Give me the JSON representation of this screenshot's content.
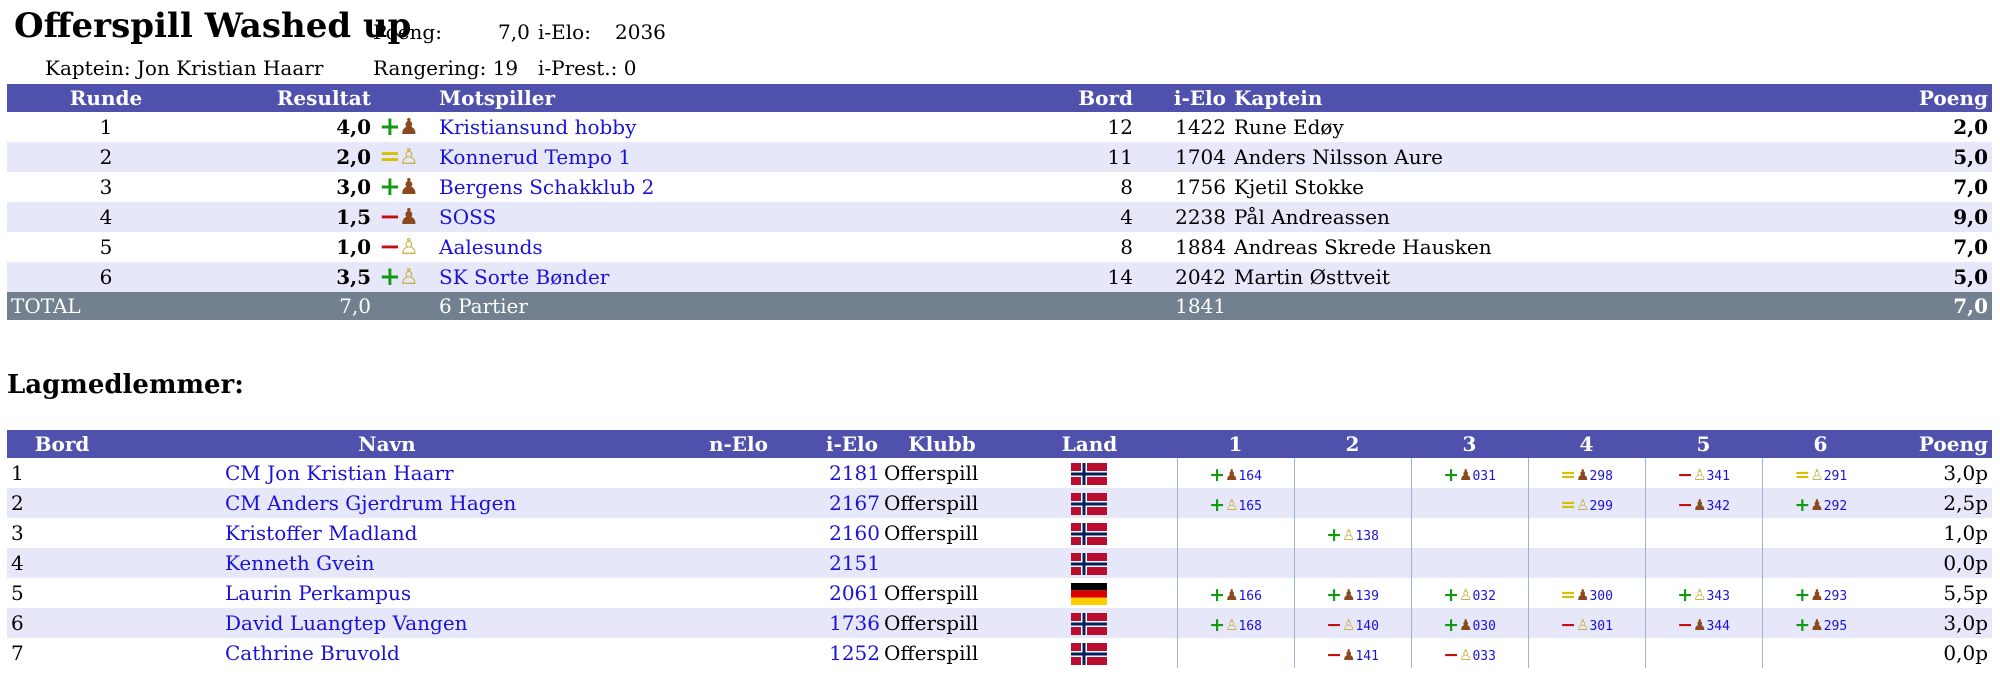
{
  "team": {
    "name": "Offerspill Washed up",
    "captain_line": "Kaptein: Jon Kristian Haarr",
    "poeng_label": "Poeng:",
    "poeng_value": "7,0",
    "ielo_label": "i-Elo:",
    "ielo_value": "2036",
    "rangering_label": "Rangering: 19",
    "iprest_label": "i-Prest.: 0"
  },
  "rounds": {
    "headers": [
      "Runde",
      "Resultat",
      "Motspiller",
      "Bord",
      "i-Elo",
      "Kaptein",
      "Poeng"
    ],
    "rows": [
      {
        "round": "1",
        "score": "4,0",
        "sym": "+",
        "sym_color": "#139a13",
        "piece": "♟",
        "piece_color": "#8b4a1e",
        "opponent": "Kristiansund hobby",
        "board": "12",
        "ielo": "1422",
        "captain": "Rune Edøy",
        "points": "2,0"
      },
      {
        "round": "2",
        "score": "2,0",
        "sym": "=",
        "sym_color": "#d4c200",
        "piece": "♙",
        "piece_color": "#c8b34a",
        "opponent": "Konnerud Tempo 1",
        "board": "11",
        "ielo": "1704",
        "captain": "Anders Nilsson Aure",
        "points": "5,0"
      },
      {
        "round": "3",
        "score": "3,0",
        "sym": "+",
        "sym_color": "#139a13",
        "piece": "♟",
        "piece_color": "#8b4a1e",
        "opponent": "Bergens Schakklub 2",
        "board": "8",
        "ielo": "1756",
        "captain": "Kjetil Stokke",
        "points": "7,0"
      },
      {
        "round": "4",
        "score": "1,5",
        "sym": "−",
        "sym_color": "#c40f0f",
        "piece": "♟",
        "piece_color": "#8b4a1e",
        "opponent": "SOSS",
        "board": "4",
        "ielo": "2238",
        "captain": "Pål Andreassen",
        "points": "9,0"
      },
      {
        "round": "5",
        "score": "1,0",
        "sym": "−",
        "sym_color": "#c40f0f",
        "piece": "♙",
        "piece_color": "#c8b34a",
        "opponent": "Aalesunds",
        "board": "8",
        "ielo": "1884",
        "captain": "Andreas Skrede Hausken",
        "points": "7,0"
      },
      {
        "round": "6",
        "score": "3,5",
        "sym": "+",
        "sym_color": "#139a13",
        "piece": "♙",
        "piece_color": "#c8b34a",
        "opponent": "SK Sorte Bønder",
        "board": "14",
        "ielo": "2042",
        "captain": "Martin Østtveit",
        "points": "5,0"
      }
    ],
    "total": {
      "label": "TOTAL",
      "score": "7,0",
      "games": "6 Partier",
      "ielo": "1841",
      "points": "7,0"
    }
  },
  "members": {
    "section_title": "Lagmedlemmer:",
    "headers": [
      "Bord",
      "Navn",
      "n-Elo",
      "i-Elo",
      "Klubb",
      "Land",
      "1",
      "2",
      "3",
      "4",
      "5",
      "6",
      "Poeng"
    ],
    "rows": [
      {
        "bord": "1",
        "name": "CM Jon Kristian Haarr",
        "nelo": "",
        "ielo": "2181",
        "club": "Offerspill",
        "country": "Norway",
        "games": [
          {
            "sym": "+",
            "color": "#139a13",
            "piece": "♟",
            "piece_color": "#8b4a1e",
            "num": "164"
          },
          null,
          {
            "sym": "+",
            "color": "#139a13",
            "piece": "♟",
            "piece_color": "#8b4a1e",
            "num": "031"
          },
          {
            "sym": "=",
            "color": "#d4c200",
            "piece": "♟",
            "piece_color": "#8b4a1e",
            "num": "298"
          },
          {
            "sym": "−",
            "color": "#c40f0f",
            "piece": "♙",
            "piece_color": "#c8b34a",
            "num": "341"
          },
          {
            "sym": "=",
            "color": "#d4c200",
            "piece": "♙",
            "piece_color": "#c8b34a",
            "num": "291"
          }
        ],
        "points": "3,0p"
      },
      {
        "bord": "2",
        "name": "CM Anders Gjerdrum Hagen",
        "nelo": "",
        "ielo": "2167",
        "club": "Offerspill",
        "country": "Norway",
        "games": [
          {
            "sym": "+",
            "color": "#139a13",
            "piece": "♙",
            "piece_color": "#c8b34a",
            "num": "165"
          },
          null,
          null,
          {
            "sym": "=",
            "color": "#d4c200",
            "piece": "♙",
            "piece_color": "#c8b34a",
            "num": "299"
          },
          {
            "sym": "−",
            "color": "#c40f0f",
            "piece": "♟",
            "piece_color": "#8b4a1e",
            "num": "342"
          },
          {
            "sym": "+",
            "color": "#139a13",
            "piece": "♟",
            "piece_color": "#8b4a1e",
            "num": "292"
          }
        ],
        "points": "2,5p"
      },
      {
        "bord": "3",
        "name": "Kristoffer Madland",
        "nelo": "",
        "ielo": "2160",
        "club": "Offerspill",
        "country": "Norway",
        "games": [
          null,
          {
            "sym": "+",
            "color": "#139a13",
            "piece": "♙",
            "piece_color": "#c8b34a",
            "num": "138"
          },
          null,
          null,
          null,
          null
        ],
        "points": "1,0p"
      },
      {
        "bord": "4",
        "name": "Kenneth Gvein",
        "nelo": "",
        "ielo": "2151",
        "club": "",
        "country": "Norway",
        "games": [
          null,
          null,
          null,
          null,
          null,
          null
        ],
        "points": "0,0p"
      },
      {
        "bord": "5",
        "name": "Laurin Perkampus",
        "nelo": "",
        "ielo": "2061",
        "club": "Offerspill",
        "country": "Germany",
        "games": [
          {
            "sym": "+",
            "color": "#139a13",
            "piece": "♟",
            "piece_color": "#8b4a1e",
            "num": "166"
          },
          {
            "sym": "+",
            "color": "#139a13",
            "piece": "♟",
            "piece_color": "#8b4a1e",
            "num": "139"
          },
          {
            "sym": "+",
            "color": "#139a13",
            "piece": "♙",
            "piece_color": "#c8b34a",
            "num": "032"
          },
          {
            "sym": "=",
            "color": "#d4c200",
            "piece": "♟",
            "piece_color": "#8b4a1e",
            "num": "300"
          },
          {
            "sym": "+",
            "color": "#139a13",
            "piece": "♙",
            "piece_color": "#c8b34a",
            "num": "343"
          },
          {
            "sym": "+",
            "color": "#139a13",
            "piece": "♟",
            "piece_color": "#8b4a1e",
            "num": "293"
          }
        ],
        "points": "5,5p"
      },
      {
        "bord": "6",
        "name": "David Luangtep Vangen",
        "nelo": "",
        "ielo": "1736",
        "club": "Offerspill",
        "country": "Norway",
        "games": [
          {
            "sym": "+",
            "color": "#139a13",
            "piece": "♙",
            "piece_color": "#c8b34a",
            "num": "168"
          },
          {
            "sym": "−",
            "color": "#c40f0f",
            "piece": "♙",
            "piece_color": "#c8b34a",
            "num": "140"
          },
          {
            "sym": "+",
            "color": "#139a13",
            "piece": "♟",
            "piece_color": "#8b4a1e",
            "num": "030"
          },
          {
            "sym": "−",
            "color": "#c40f0f",
            "piece": "♙",
            "piece_color": "#c8b34a",
            "num": "301"
          },
          {
            "sym": "−",
            "color": "#c40f0f",
            "piece": "♟",
            "piece_color": "#8b4a1e",
            "num": "344"
          },
          {
            "sym": "+",
            "color": "#139a13",
            "piece": "♟",
            "piece_color": "#8b4a1e",
            "num": "295"
          }
        ],
        "points": "3,0p"
      },
      {
        "bord": "7",
        "name": "Cathrine Bruvold",
        "nelo": "",
        "ielo": "1252",
        "club": "Offerspill",
        "country": "Norway",
        "games": [
          null,
          {
            "sym": "−",
            "color": "#c40f0f",
            "piece": "♟",
            "piece_color": "#8b4a1e",
            "num": "141"
          },
          {
            "sym": "−",
            "color": "#c40f0f",
            "piece": "♙",
            "piece_color": "#c8b34a",
            "num": "033"
          },
          null,
          null,
          null
        ],
        "points": "0,0p"
      }
    ]
  }
}
